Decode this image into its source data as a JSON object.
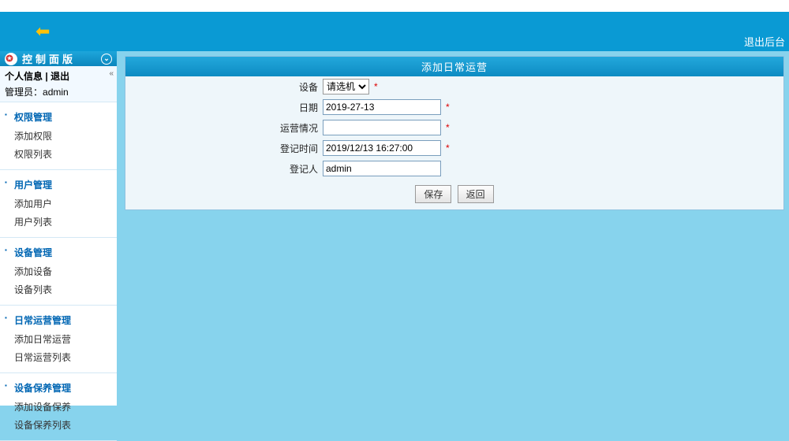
{
  "topbar": {
    "back_icon": "⬅",
    "logout": "退出后台"
  },
  "sidebar": {
    "panel_title": "控制面版",
    "userinfo": {
      "personal_info": "个人信息",
      "logout": "退出",
      "role_label": "管理员：",
      "username": "admin"
    },
    "menus": [
      {
        "title": "权限管理",
        "items": [
          "添加权限",
          "权限列表"
        ]
      },
      {
        "title": "用户管理",
        "items": [
          "添加用户",
          "用户列表"
        ]
      },
      {
        "title": "设备管理",
        "items": [
          "添加设备",
          "设备列表"
        ]
      },
      {
        "title": "日常运营管理",
        "items": [
          "添加日常运营",
          "日常运营列表"
        ]
      },
      {
        "title": "设备保养管理",
        "items": [
          "添加设备保养",
          "设备保养列表"
        ]
      }
    ]
  },
  "form": {
    "title": "添加日常运营",
    "fields": {
      "device": {
        "label": "设备",
        "selected": "请选机",
        "required": true
      },
      "date": {
        "label": "日期",
        "value": "2019-27-13",
        "required": true
      },
      "status": {
        "label": "运营情况",
        "value": "",
        "required": true
      },
      "regtime": {
        "label": "登记时间",
        "value": "2019/12/13 16:27:00",
        "required": true
      },
      "registrant": {
        "label": "登记人",
        "value": "admin"
      }
    },
    "buttons": {
      "save": "保存",
      "back": "返回"
    }
  }
}
